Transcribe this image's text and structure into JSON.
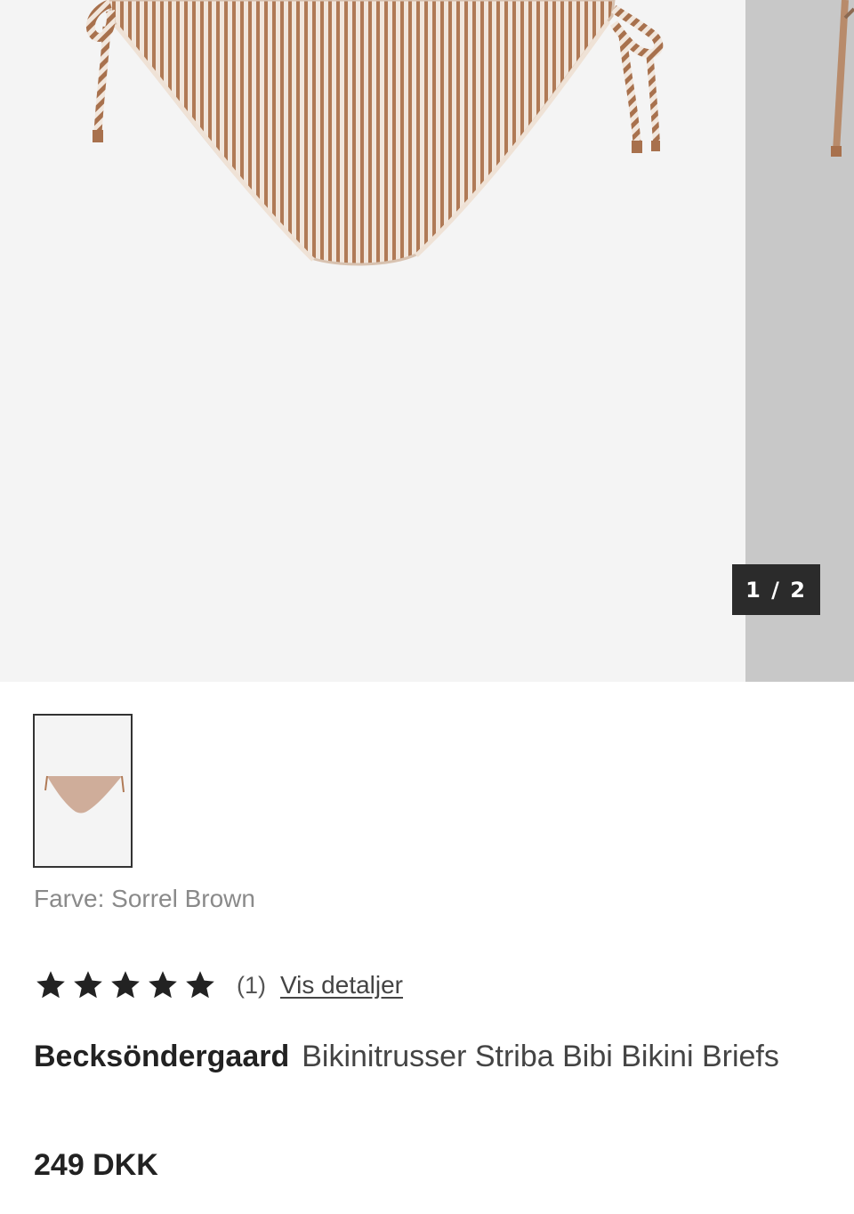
{
  "gallery": {
    "counter": "1 / 2",
    "current_image": 1,
    "total_images": 2
  },
  "color": {
    "label": "Farve:",
    "value": "Sorrel Brown"
  },
  "rating": {
    "stars_filled": 5,
    "stars_total": 5,
    "count_text": "(1)",
    "details_link": "Vis detaljer"
  },
  "product": {
    "brand": "Becksöndergaard",
    "name": "Bikinitrusser Striba Bibi Bikini Briefs",
    "price": "249 DKK"
  },
  "colors": {
    "image_background": "#f4f4f4",
    "next_slide_background": "#c8c8c8",
    "stripe_brown": "#b07a56",
    "stripe_light": "#f1e6dc",
    "counter_background": "#2b2b2b"
  }
}
